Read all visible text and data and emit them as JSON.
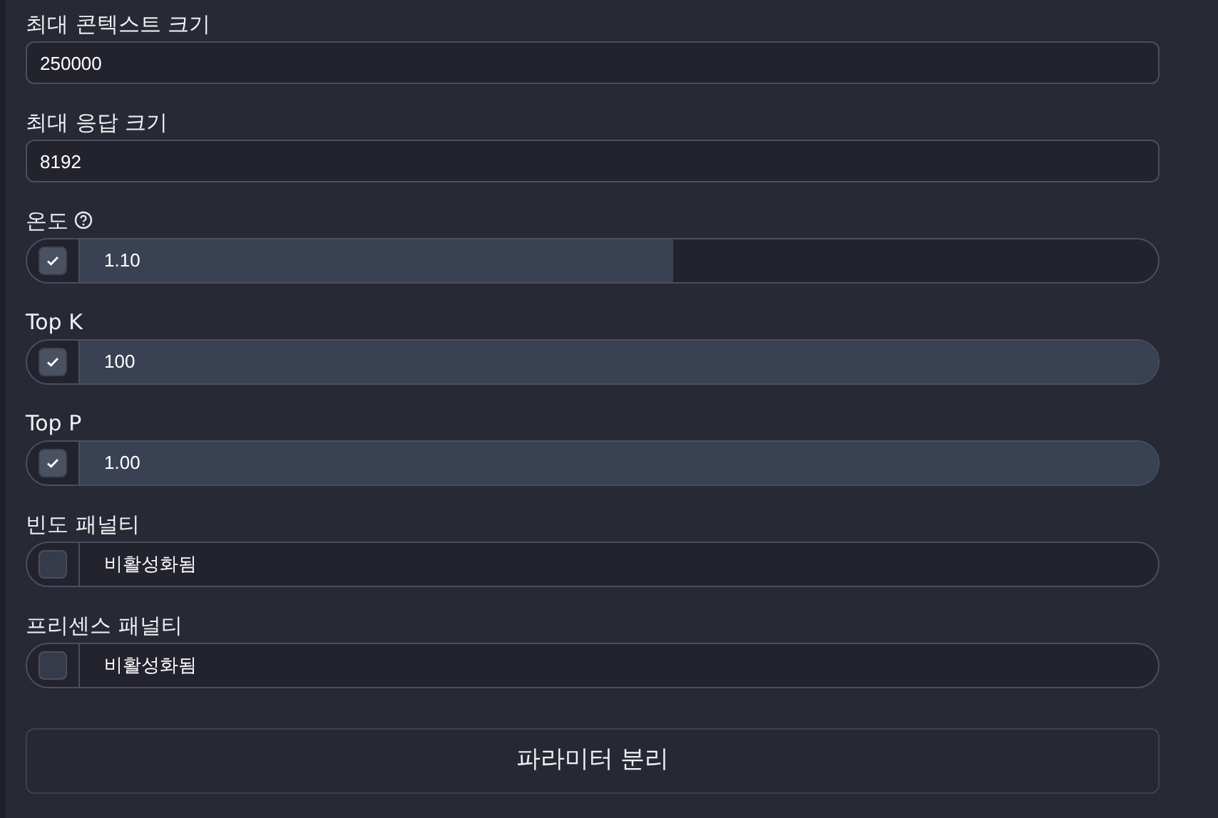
{
  "fields": [
    {
      "kind": "number",
      "label": "최대 콘텍스트 크기",
      "value": "250000"
    },
    {
      "kind": "number",
      "label": "최대 응답 크기",
      "value": "8192"
    },
    {
      "kind": "slider",
      "label": "온도",
      "help": true,
      "checked": true,
      "level": 0.55,
      "value": "1.10"
    },
    {
      "kind": "slider",
      "label": "Top K",
      "checked": true,
      "level": 1,
      "value": "100"
    },
    {
      "kind": "slider",
      "label": "Top P",
      "checked": true,
      "level": 1,
      "value": "1.00"
    },
    {
      "kind": "slider",
      "label": "빈도 패널티",
      "checked": false,
      "value": "비활성화됨"
    },
    {
      "kind": "slider",
      "label": "프리센스 패널티",
      "checked": false,
      "value": "비활성화됨"
    }
  ],
  "button": "파라미터 분리"
}
